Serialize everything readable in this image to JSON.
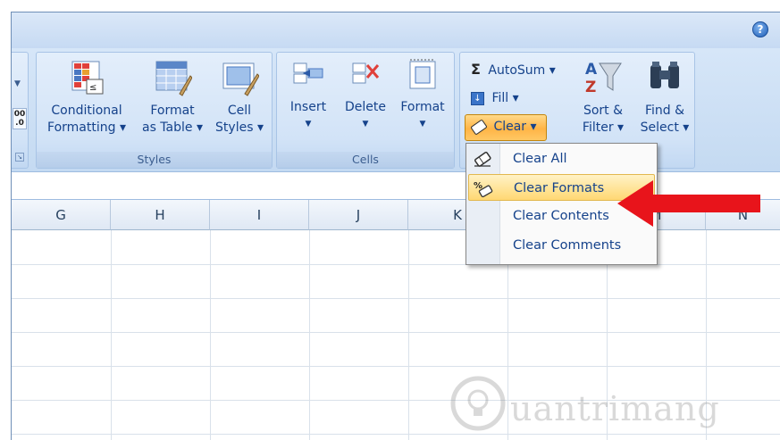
{
  "help_label": "?",
  "ribbon": {
    "styles_group": {
      "label": "Styles",
      "conditional_formatting": {
        "line1": "Conditional",
        "line2": "Formatting ▾"
      },
      "format_as_table": {
        "line1": "Format",
        "line2": "as Table ▾"
      },
      "cell_styles": {
        "line1": "Cell",
        "line2": "Styles ▾"
      }
    },
    "cells_group": {
      "label": "Cells",
      "insert": "Insert",
      "delete": "Delete",
      "format": "Format"
    },
    "editing_group": {
      "autosum": "AutoSum ▾",
      "autosum_symbol": "Σ",
      "fill": "Fill ▾",
      "clear": "Clear ▾",
      "sort_filter": {
        "line1": "Sort &",
        "line2": "Filter ▾"
      },
      "find_select": {
        "line1": "Find &",
        "line2": "Select ▾"
      }
    },
    "left_partial": {
      "number_format": "00\n.0"
    }
  },
  "columns": [
    "G",
    "H",
    "I",
    "J",
    "K",
    "M",
    "N"
  ],
  "clear_menu": {
    "items": [
      {
        "label": "Clear All",
        "icon": "eraser-icon"
      },
      {
        "label": "Clear Formats",
        "icon": "clear-formats-icon",
        "highlighted": true
      },
      {
        "label": "Clear Contents",
        "icon": "none"
      },
      {
        "label": "Clear Comments",
        "icon": "none"
      }
    ]
  },
  "watermark": {
    "text": "uantrimang"
  },
  "colors": {
    "arrow": "#e8141b",
    "highlight": "#ffd873",
    "ribbon": "#c3d9f1"
  }
}
